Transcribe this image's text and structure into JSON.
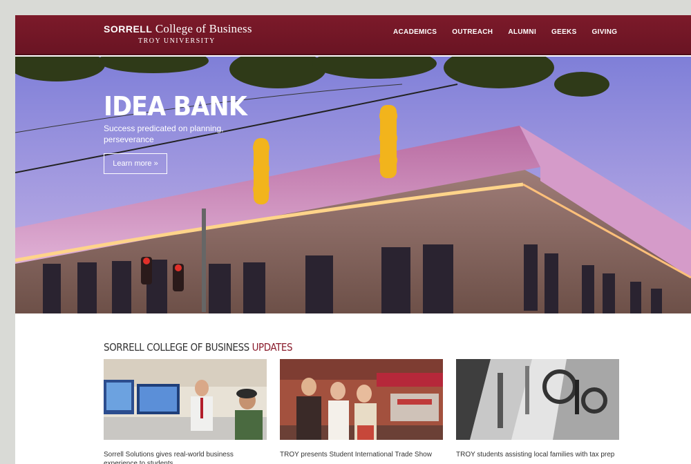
{
  "header": {
    "logo_bold": "SORRELL",
    "logo_rest": " College of Business",
    "logo_sub": "TROY UNIVERSITY",
    "nav": [
      "ACADEMICS",
      "OUTREACH",
      "ALUMNI",
      "GEEKS",
      "GIVING"
    ]
  },
  "hero": {
    "title": "IDEA BANK",
    "subtitle": "Success predicated on planning, perseverance",
    "button_label": "Learn more »"
  },
  "updates": {
    "title_main": "SORRELL COLLEGE OF BUSINESS",
    "title_accent": " UPDATES",
    "cards": [
      {
        "caption": "Sorrell Solutions gives real-world business experience to students"
      },
      {
        "caption": "TROY presents Student International Trade Show"
      },
      {
        "caption": "TROY students assisting local families with tax prep"
      }
    ]
  },
  "colors": {
    "brand_maroon": "#7c1a2a",
    "accent": "#8a1c2c"
  }
}
